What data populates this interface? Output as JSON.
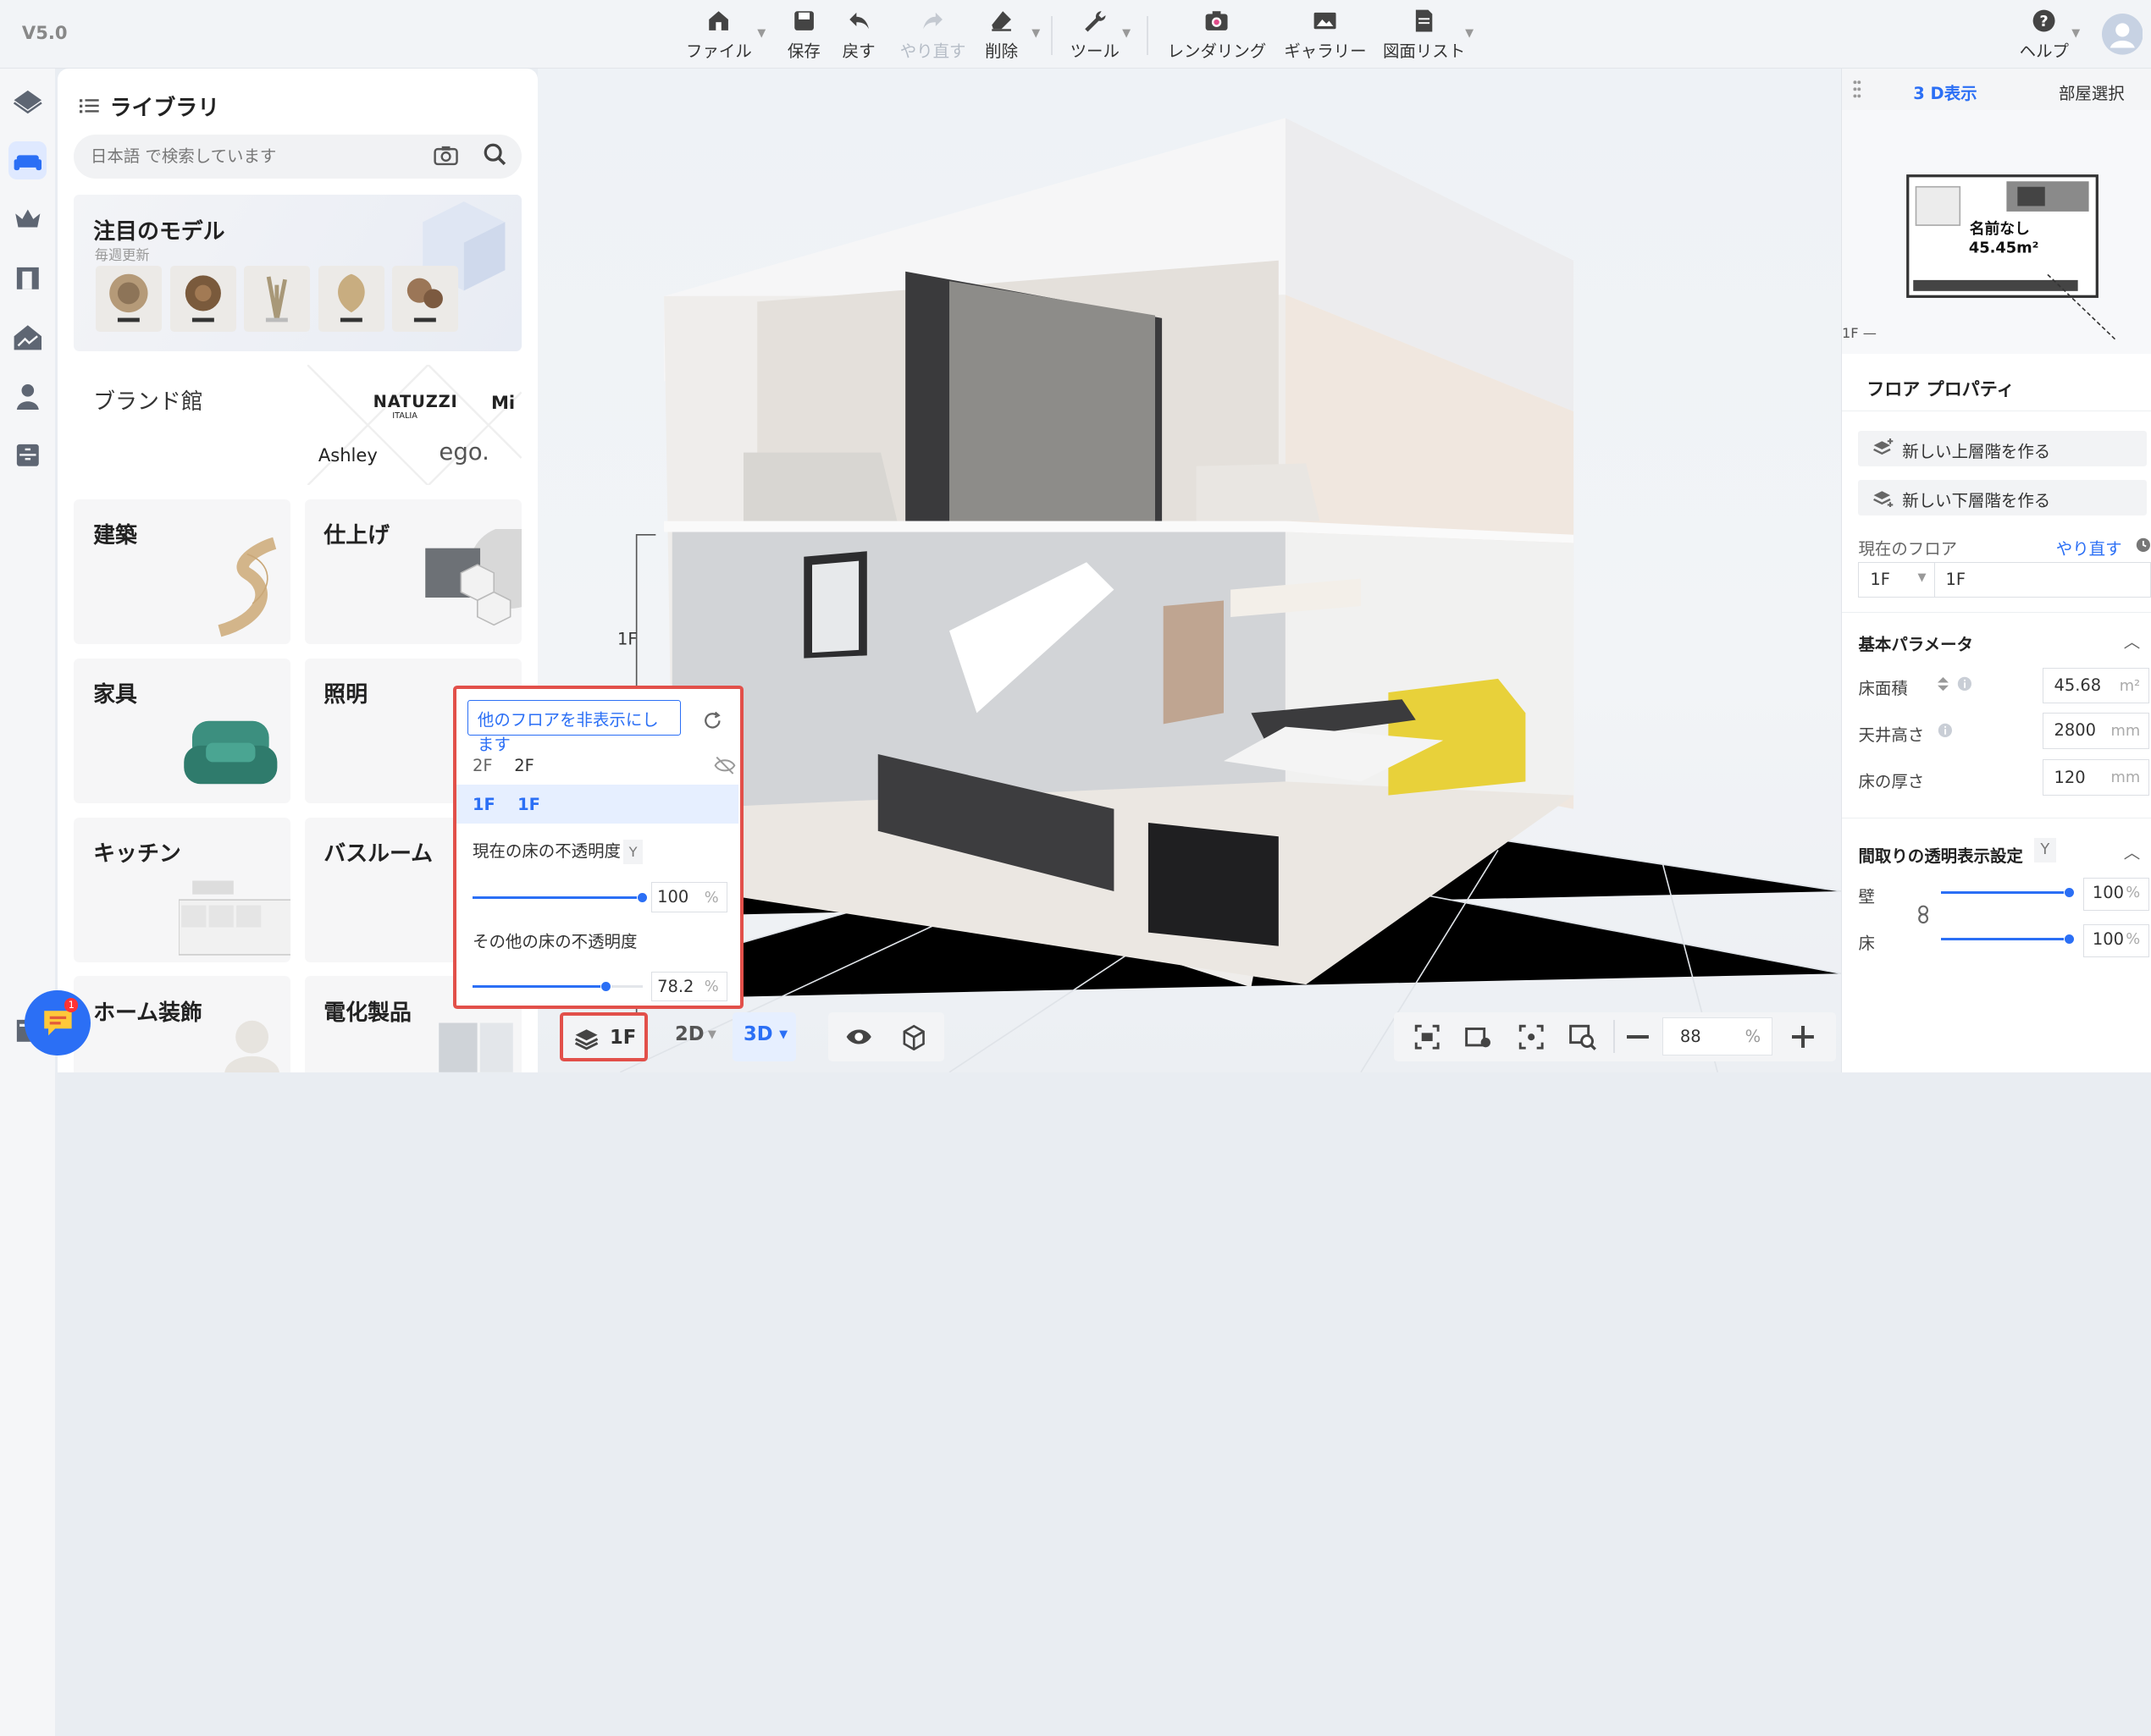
{
  "app": {
    "version": "V5.0"
  },
  "toolbar": {
    "file": "ファイル",
    "save": "保存",
    "undo": "戻す",
    "redo": "やり直す",
    "delete": "削除",
    "tools": "ツール",
    "rendering": "レンダリング",
    "gallery": "ギャラリー",
    "drawing_list": "図面リスト",
    "help": "ヘルプ"
  },
  "library": {
    "title": "ライブラリ",
    "search_placeholder": "日本語 で検索しています",
    "featured": {
      "title": "注目のモデル",
      "subtitle": "毎週更新"
    },
    "brand": {
      "title": "ブランド館",
      "logos": [
        "NATUZZI",
        "ITALIA",
        "Ashley",
        "ego.",
        "Mi"
      ]
    },
    "categories": [
      "建築",
      "仕上げ",
      "家具",
      "照明",
      "キッチン",
      "バスルーム",
      "ホーム装飾",
      "電化製品"
    ]
  },
  "viewport": {
    "floor_label": "1F"
  },
  "right_panel": {
    "tabs": [
      "3 D表示",
      "部屋選択"
    ],
    "minimap": {
      "room_name": "名前なし",
      "room_area": "45.45m²",
      "floor_marker": "1F —"
    },
    "floor_properties": {
      "title": "フロア プロパティ",
      "new_upper": "新しい上層階を作る",
      "new_lower": "新しい下層階を作る",
      "current_floor_label": "現在のフロア",
      "redo_link": "やり直す",
      "floor_select": "1F",
      "floor_name": "1F"
    },
    "basic_params": {
      "title": "基本パラメータ",
      "floor_area_label": "床面積",
      "floor_area": "45.68",
      "floor_area_unit": "m²",
      "ceiling_height_label": "天井高さ",
      "ceiling_height": "2800",
      "ceiling_height_unit": "mm",
      "floor_thickness_label": "床の厚さ",
      "floor_thickness": "120",
      "floor_thickness_unit": "mm"
    },
    "transparency": {
      "title": "間取りの透明表示設定",
      "shortcut": "Y",
      "wall_label": "壁",
      "wall_value": "100",
      "wall_level": 1.0,
      "floor_label": "床",
      "floor_value": "100",
      "floor_level": 1.0,
      "unit": "%"
    }
  },
  "floor_popup": {
    "hide_other_floors": "他のフロアを非表示にします",
    "floors": [
      {
        "code": "2F",
        "name": "2F"
      },
      {
        "code": "1F",
        "name": "1F"
      }
    ],
    "current_opacity_label": "現在の床の不透明度",
    "current_opacity_shortcut": "Y",
    "current_opacity": "100",
    "current_opacity_level": 1.0,
    "other_opacity_label": "その他の床の不透明度",
    "other_opacity": "78.2",
    "other_opacity_level": 0.782,
    "unit": "%"
  },
  "bottom_bar": {
    "floor_button": "1F",
    "view_2d": "2D",
    "view_3d": "3D",
    "zoom": "88",
    "zoom_unit": "%"
  },
  "chat": {
    "badge": "1"
  },
  "colors": {
    "accent": "#2b6ff5",
    "highlight_border": "#e2504a"
  }
}
